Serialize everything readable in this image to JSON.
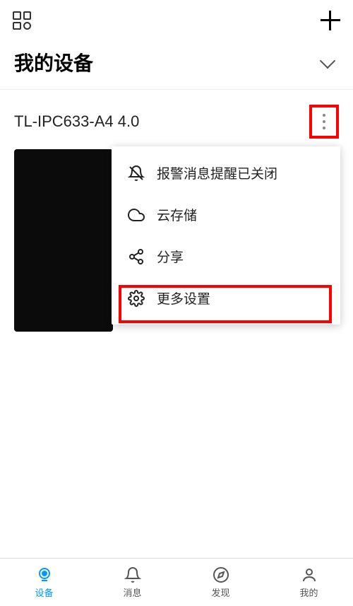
{
  "header": {
    "title": "我的设备"
  },
  "device": {
    "name": "TL-IPC633-A4 4.0"
  },
  "menu": {
    "alarm_off": "报警消息提醒已关闭",
    "cloud_storage": "云存储",
    "share": "分享",
    "more_settings": "更多设置"
  },
  "nav": {
    "device": "设备",
    "message": "消息",
    "discover": "发现",
    "mine": "我的"
  }
}
